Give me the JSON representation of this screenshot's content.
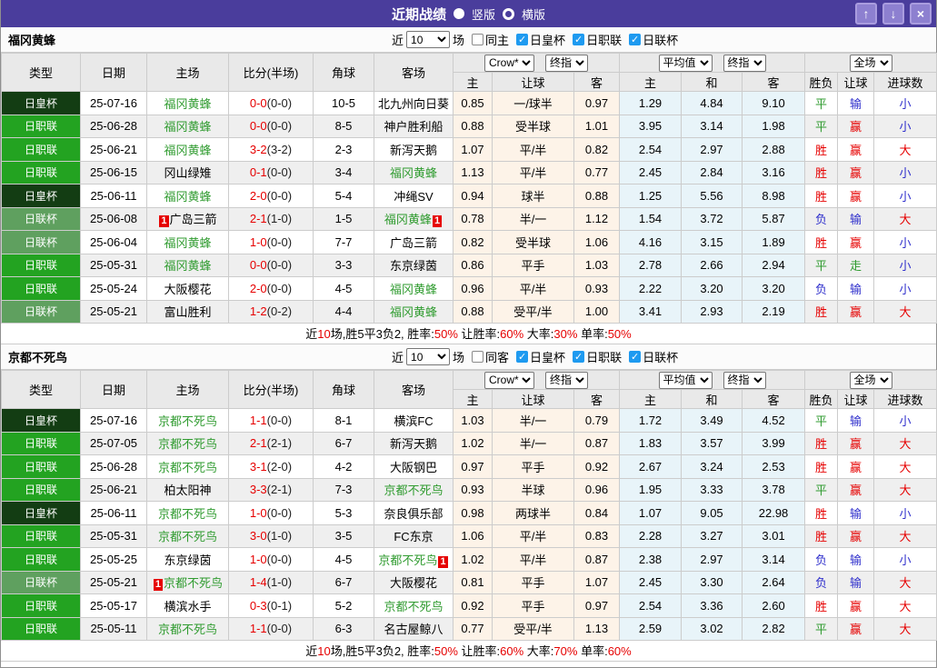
{
  "titlebar": {
    "title": "近期战绩",
    "vertical_label": "竖版",
    "horizontal_label": "横版"
  },
  "icons": {
    "check": "✓",
    "up_arrow": "↑",
    "down_arrow": "↓",
    "close": "×"
  },
  "colors": {
    "titlebar_purple": "#4a3d9c",
    "emperor_cup_green": "#133d13",
    "j_league_green": "#23a321",
    "league_cup_green": "#5fa05f",
    "focus_team_green": "#2f9b2f",
    "score_red": "#e60000",
    "loss_blue": "#3030cc",
    "checkbox_blue": "#1e9af0",
    "handicap_col_bg": "#fdf3e8",
    "average_col_bg": "#e8f4f9"
  },
  "controls": {
    "odds_source": "Crow*",
    "final_odds": "终指",
    "average": "平均值",
    "final_odds2": "终指",
    "scope": "全场"
  },
  "columns": {
    "type": "类型",
    "date": "日期",
    "home": "主场",
    "score": "比分(半场)",
    "corner": "角球",
    "away": "客场",
    "home_odds": "主",
    "handicap": "让球",
    "away_odds": "客",
    "avg_home": "主",
    "avg_draw": "和",
    "avg_away": "客",
    "result": "胜负",
    "handicap_result": "让球",
    "goals": "进球数"
  },
  "sections": [
    {
      "team": "福冈黄蜂",
      "filter": {
        "near": "近",
        "count": "10",
        "games": "场",
        "same": "同主",
        "cups": [
          "日皇杯",
          "日职联",
          "日联杯"
        ]
      },
      "rows": [
        {
          "type": "日皇杯",
          "date": "25-07-16",
          "home": "福冈黄蜂",
          "hf": true,
          "hcard": "",
          "score": "0-0",
          "half": "(0-0)",
          "corner": "10-5",
          "away": "北九州向日葵",
          "af": false,
          "acard": "",
          "o1": "0.85",
          "hand": "一/球半",
          "o2": "0.97",
          "a1": "1.29",
          "a2": "4.84",
          "a3": "9.10",
          "wl": "平",
          "hr": "输",
          "gr": "小"
        },
        {
          "type": "日职联",
          "date": "25-06-28",
          "home": "福冈黄蜂",
          "hf": true,
          "hcard": "",
          "score": "0-0",
          "half": "(0-0)",
          "corner": "8-5",
          "away": "神户胜利船",
          "af": false,
          "acard": "",
          "o1": "0.88",
          "hand": "受半球",
          "o2": "1.01",
          "a1": "3.95",
          "a2": "3.14",
          "a3": "1.98",
          "wl": "平",
          "hr": "赢",
          "gr": "小"
        },
        {
          "type": "日职联",
          "date": "25-06-21",
          "home": "福冈黄蜂",
          "hf": true,
          "hcard": "",
          "score": "3-2",
          "half": "(3-2)",
          "corner": "2-3",
          "away": "新泻天鹅",
          "af": false,
          "acard": "",
          "o1": "1.07",
          "hand": "平/半",
          "o2": "0.82",
          "a1": "2.54",
          "a2": "2.97",
          "a3": "2.88",
          "wl": "胜",
          "hr": "赢",
          "gr": "大"
        },
        {
          "type": "日职联",
          "date": "25-06-15",
          "home": "冈山绿雉",
          "hf": false,
          "hcard": "",
          "score": "0-1",
          "half": "(0-0)",
          "corner": "3-4",
          "away": "福冈黄蜂",
          "af": true,
          "acard": "",
          "o1": "1.13",
          "hand": "平/半",
          "o2": "0.77",
          "a1": "2.45",
          "a2": "2.84",
          "a3": "3.16",
          "wl": "胜",
          "hr": "赢",
          "gr": "小"
        },
        {
          "type": "日皇杯",
          "date": "25-06-11",
          "home": "福冈黄蜂",
          "hf": true,
          "hcard": "",
          "score": "2-0",
          "half": "(0-0)",
          "corner": "5-4",
          "away": "冲绳SV",
          "af": false,
          "acard": "",
          "o1": "0.94",
          "hand": "球半",
          "o2": "0.88",
          "a1": "1.25",
          "a2": "5.56",
          "a3": "8.98",
          "wl": "胜",
          "hr": "赢",
          "gr": "小"
        },
        {
          "type": "日联杯",
          "date": "25-06-08",
          "home": "广岛三箭",
          "hf": false,
          "hcard": "1",
          "score": "2-1",
          "half": "(1-0)",
          "corner": "1-5",
          "away": "福冈黄蜂",
          "af": true,
          "acard": "1",
          "o1": "0.78",
          "hand": "半/一",
          "o2": "1.12",
          "a1": "1.54",
          "a2": "3.72",
          "a3": "5.87",
          "wl": "负",
          "hr": "输",
          "gr": "大"
        },
        {
          "type": "日联杯",
          "date": "25-06-04",
          "home": "福冈黄蜂",
          "hf": true,
          "hcard": "",
          "score": "1-0",
          "half": "(0-0)",
          "corner": "7-7",
          "away": "广岛三箭",
          "af": false,
          "acard": "",
          "o1": "0.82",
          "hand": "受半球",
          "o2": "1.06",
          "a1": "4.16",
          "a2": "3.15",
          "a3": "1.89",
          "wl": "胜",
          "hr": "赢",
          "gr": "小"
        },
        {
          "type": "日职联",
          "date": "25-05-31",
          "home": "福冈黄蜂",
          "hf": true,
          "hcard": "",
          "score": "0-0",
          "half": "(0-0)",
          "corner": "3-3",
          "away": "东京绿茵",
          "af": false,
          "acard": "",
          "o1": "0.86",
          "hand": "平手",
          "o2": "1.03",
          "a1": "2.78",
          "a2": "2.66",
          "a3": "2.94",
          "wl": "平",
          "hr": "走",
          "gr": "小"
        },
        {
          "type": "日职联",
          "date": "25-05-24",
          "home": "大阪樱花",
          "hf": false,
          "hcard": "",
          "score": "2-0",
          "half": "(0-0)",
          "corner": "4-5",
          "away": "福冈黄蜂",
          "af": true,
          "acard": "",
          "o1": "0.96",
          "hand": "平/半",
          "o2": "0.93",
          "a1": "2.22",
          "a2": "3.20",
          "a3": "3.20",
          "wl": "负",
          "hr": "输",
          "gr": "小"
        },
        {
          "type": "日联杯",
          "date": "25-05-21",
          "home": "富山胜利",
          "hf": false,
          "hcard": "",
          "score": "1-2",
          "half": "(0-2)",
          "corner": "4-4",
          "away": "福冈黄蜂",
          "af": true,
          "acard": "",
          "o1": "0.88",
          "hand": "受平/半",
          "o2": "1.00",
          "a1": "3.41",
          "a2": "2.93",
          "a3": "2.19",
          "wl": "胜",
          "hr": "赢",
          "gr": "大"
        }
      ],
      "summary": [
        {
          "t": "近",
          "r": false
        },
        {
          "t": "10",
          "r": true
        },
        {
          "t": "场,胜5平3负2, 胜率:",
          "r": false
        },
        {
          "t": "50%",
          "r": true
        },
        {
          "t": " 让胜率:",
          "r": false
        },
        {
          "t": "60%",
          "r": true
        },
        {
          "t": " 大率:",
          "r": false
        },
        {
          "t": "30%",
          "r": true
        },
        {
          "t": " 单率:",
          "r": false
        },
        {
          "t": "50%",
          "r": true
        }
      ]
    },
    {
      "team": "京都不死鸟",
      "filter": {
        "near": "近",
        "count": "10",
        "games": "场",
        "same": "同客",
        "cups": [
          "日皇杯",
          "日职联",
          "日联杯"
        ]
      },
      "rows": [
        {
          "type": "日皇杯",
          "date": "25-07-16",
          "home": "京都不死鸟",
          "hf": true,
          "hcard": "",
          "score": "1-1",
          "half": "(0-0)",
          "corner": "8-1",
          "away": "横滨FC",
          "af": false,
          "acard": "",
          "o1": "1.03",
          "hand": "半/一",
          "o2": "0.79",
          "a1": "1.72",
          "a2": "3.49",
          "a3": "4.52",
          "wl": "平",
          "hr": "输",
          "gr": "小"
        },
        {
          "type": "日职联",
          "date": "25-07-05",
          "home": "京都不死鸟",
          "hf": true,
          "hcard": "",
          "score": "2-1",
          "half": "(2-1)",
          "corner": "6-7",
          "away": "新泻天鹅",
          "af": false,
          "acard": "",
          "o1": "1.02",
          "hand": "半/一",
          "o2": "0.87",
          "a1": "1.83",
          "a2": "3.57",
          "a3": "3.99",
          "wl": "胜",
          "hr": "赢",
          "gr": "大"
        },
        {
          "type": "日职联",
          "date": "25-06-28",
          "home": "京都不死鸟",
          "hf": true,
          "hcard": "",
          "score": "3-1",
          "half": "(2-0)",
          "corner": "4-2",
          "away": "大阪钢巴",
          "af": false,
          "acard": "",
          "o1": "0.97",
          "hand": "平手",
          "o2": "0.92",
          "a1": "2.67",
          "a2": "3.24",
          "a3": "2.53",
          "wl": "胜",
          "hr": "赢",
          "gr": "大"
        },
        {
          "type": "日职联",
          "date": "25-06-21",
          "home": "柏太阳神",
          "hf": false,
          "hcard": "",
          "score": "3-3",
          "half": "(2-1)",
          "corner": "7-3",
          "away": "京都不死鸟",
          "af": true,
          "acard": "",
          "o1": "0.93",
          "hand": "半球",
          "o2": "0.96",
          "a1": "1.95",
          "a2": "3.33",
          "a3": "3.78",
          "wl": "平",
          "hr": "赢",
          "gr": "大"
        },
        {
          "type": "日皇杯",
          "date": "25-06-11",
          "home": "京都不死鸟",
          "hf": true,
          "hcard": "",
          "score": "1-0",
          "half": "(0-0)",
          "corner": "5-3",
          "away": "奈良俱乐部",
          "af": false,
          "acard": "",
          "o1": "0.98",
          "hand": "两球半",
          "o2": "0.84",
          "a1": "1.07",
          "a2": "9.05",
          "a3": "22.98",
          "wl": "胜",
          "hr": "输",
          "gr": "小"
        },
        {
          "type": "日职联",
          "date": "25-05-31",
          "home": "京都不死鸟",
          "hf": true,
          "hcard": "",
          "score": "3-0",
          "half": "(1-0)",
          "corner": "3-5",
          "away": "FC东京",
          "af": false,
          "acard": "",
          "o1": "1.06",
          "hand": "平/半",
          "o2": "0.83",
          "a1": "2.28",
          "a2": "3.27",
          "a3": "3.01",
          "wl": "胜",
          "hr": "赢",
          "gr": "大"
        },
        {
          "type": "日职联",
          "date": "25-05-25",
          "home": "东京绿茵",
          "hf": false,
          "hcard": "",
          "score": "1-0",
          "half": "(0-0)",
          "corner": "4-5",
          "away": "京都不死鸟",
          "af": true,
          "acard": "1",
          "o1": "1.02",
          "hand": "平/半",
          "o2": "0.87",
          "a1": "2.38",
          "a2": "2.97",
          "a3": "3.14",
          "wl": "负",
          "hr": "输",
          "gr": "小"
        },
        {
          "type": "日联杯",
          "date": "25-05-21",
          "home": "京都不死鸟",
          "hf": true,
          "hcard": "1",
          "score": "1-4",
          "half": "(1-0)",
          "corner": "6-7",
          "away": "大阪樱花",
          "af": false,
          "acard": "",
          "o1": "0.81",
          "hand": "平手",
          "o2": "1.07",
          "a1": "2.45",
          "a2": "3.30",
          "a3": "2.64",
          "wl": "负",
          "hr": "输",
          "gr": "大"
        },
        {
          "type": "日职联",
          "date": "25-05-17",
          "home": "横滨水手",
          "hf": false,
          "hcard": "",
          "score": "0-3",
          "half": "(0-1)",
          "corner": "5-2",
          "away": "京都不死鸟",
          "af": true,
          "acard": "",
          "o1": "0.92",
          "hand": "平手",
          "o2": "0.97",
          "a1": "2.54",
          "a2": "3.36",
          "a3": "2.60",
          "wl": "胜",
          "hr": "赢",
          "gr": "大"
        },
        {
          "type": "日职联",
          "date": "25-05-11",
          "home": "京都不死鸟",
          "hf": true,
          "hcard": "",
          "score": "1-1",
          "half": "(0-0)",
          "corner": "6-3",
          "away": "名古屋鲸八",
          "af": false,
          "acard": "",
          "o1": "0.77",
          "hand": "受平/半",
          "o2": "1.13",
          "a1": "2.59",
          "a2": "3.02",
          "a3": "2.82",
          "wl": "平",
          "hr": "赢",
          "gr": "大"
        }
      ],
      "summary": [
        {
          "t": "近",
          "r": false
        },
        {
          "t": "10",
          "r": true
        },
        {
          "t": "场,胜5平3负2, 胜率:",
          "r": false
        },
        {
          "t": "50%",
          "r": true
        },
        {
          "t": " 让胜率:",
          "r": false
        },
        {
          "t": "60%",
          "r": true
        },
        {
          "t": " 大率:",
          "r": false
        },
        {
          "t": "70%",
          "r": true
        },
        {
          "t": " 单率:",
          "r": false
        },
        {
          "t": "60%",
          "r": true
        }
      ]
    }
  ]
}
